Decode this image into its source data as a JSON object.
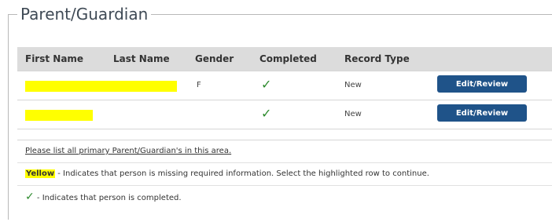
{
  "legend": "Parent/Guardian",
  "table": {
    "headers": [
      "First Name",
      "Last Name",
      "Gender",
      "Completed",
      "Record Type"
    ],
    "rows": [
      {
        "gender": "F",
        "completed_icon": "check-icon",
        "record_type": "New",
        "action": "Edit/Review"
      },
      {
        "gender": "",
        "completed_icon": "check-icon",
        "record_type": "New",
        "action": "Edit/Review"
      }
    ]
  },
  "notes": {
    "instruction": "Please list all primary Parent/Guardian's in this area.",
    "yellow_word": "Yellow",
    "yellow_text": " - Indicates that person is missing required information. Select the highlighted row to continue.",
    "check_text": " - Indicates that person is completed."
  },
  "colors": {
    "highlight": "#ffff00",
    "button": "#1f5389",
    "check": "#2e8b2e",
    "header_bg": "#dcdcdc"
  }
}
